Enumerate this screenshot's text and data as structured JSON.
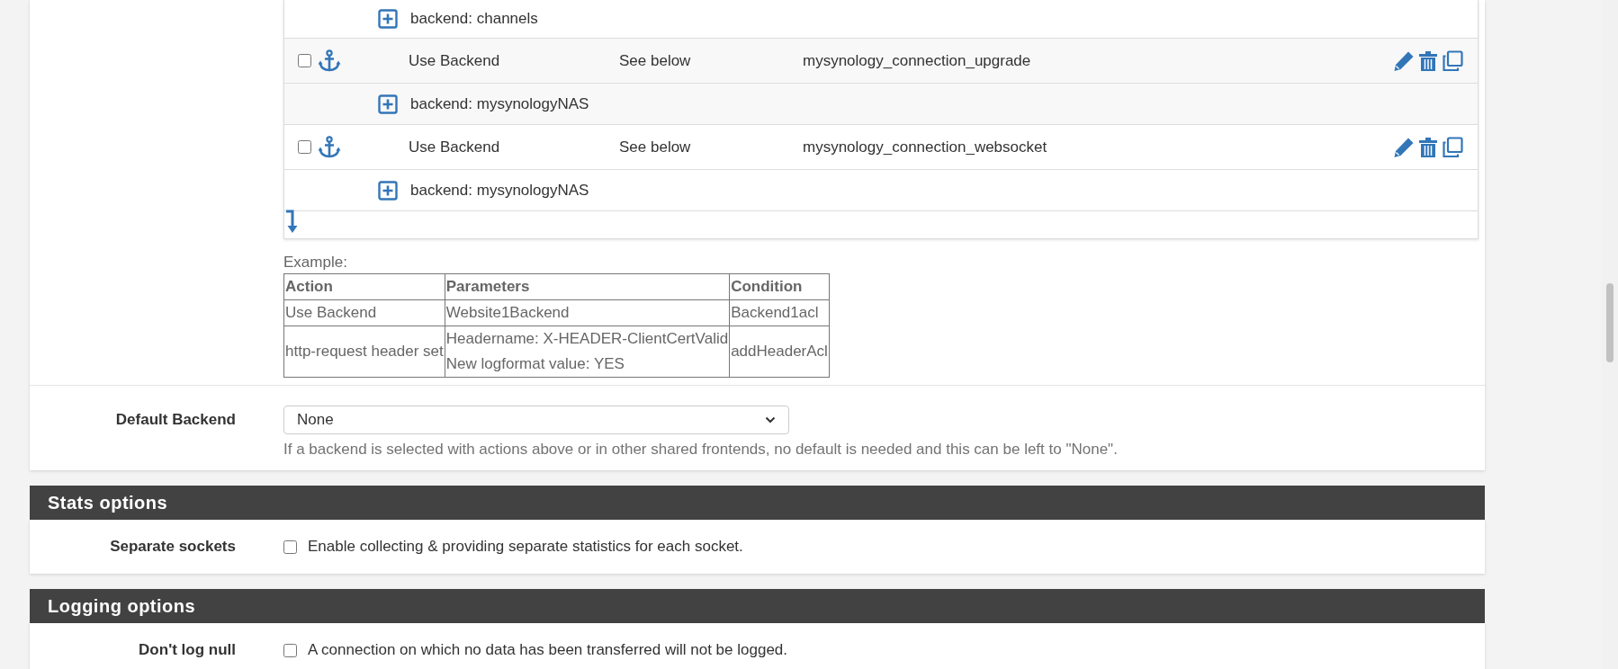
{
  "actions_table": {
    "rows": [
      {
        "kind": "group",
        "label": "backend: channels"
      },
      {
        "kind": "action",
        "checked": false,
        "action": "Use Backend",
        "parameters": "See below",
        "condition": "mysynology_connection_upgrade"
      },
      {
        "kind": "group",
        "label": "backend: mysynologyNAS"
      },
      {
        "kind": "action",
        "checked": false,
        "action": "Use Backend",
        "parameters": "See below",
        "condition": "mysynology_connection_websocket"
      },
      {
        "kind": "group",
        "label": "backend: mysynologyNAS"
      }
    ]
  },
  "example": {
    "label": "Example:",
    "columns": [
      "Action",
      "Parameters",
      "Condition"
    ],
    "rows": [
      [
        "Use Backend",
        [
          "Website1Backend"
        ],
        "Backend1acl"
      ],
      [
        "http-request header set",
        [
          "Headername: X-HEADER-ClientCertValid",
          "New logformat value: YES"
        ],
        "addHeaderAcl"
      ]
    ]
  },
  "default_backend": {
    "label": "Default Backend",
    "value": "None",
    "hint": "If a backend is selected with actions above or in other shared frontends, no default is needed and this can be left to \"None\"."
  },
  "sections": [
    {
      "title": "Stats options",
      "fields": [
        {
          "label": "Separate sockets",
          "checked": false,
          "text": "Enable collecting & providing separate statistics for each socket."
        }
      ]
    },
    {
      "title": "Logging options",
      "fields": [
        {
          "label": "Don't log null",
          "checked": false,
          "text": "A connection on which no data has been transferred will not be logged."
        }
      ]
    }
  ]
}
